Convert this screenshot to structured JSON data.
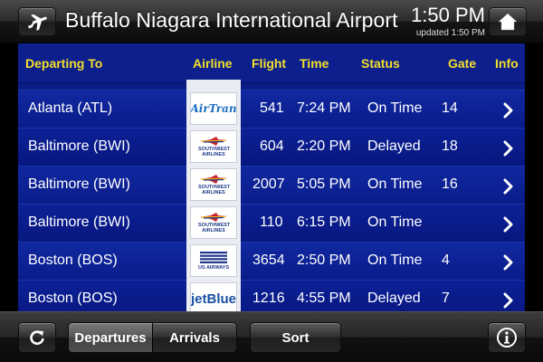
{
  "header": {
    "title": "Buffalo Niagara International Airport",
    "time": "1:50 PM",
    "updated": "updated 1:50 PM",
    "left_icon": "airplane-icon",
    "right_icon": "home-icon"
  },
  "columns": {
    "departing_to": "Departing To",
    "airline": "Airline",
    "flight": "Flight",
    "time": "Time",
    "status": "Status",
    "gate": "Gate",
    "info": "Info"
  },
  "flights": [
    {
      "destination": "Atlanta (ATL)",
      "airline_logo": "AirTran",
      "flight": "541",
      "time": "7:24 PM",
      "status": "On Time",
      "gate": "14"
    },
    {
      "destination": "Baltimore (BWI)",
      "airline_logo": "SOUTHWEST AIRLINES",
      "flight": "604",
      "time": "2:20 PM",
      "status": "Delayed",
      "gate": "18"
    },
    {
      "destination": "Baltimore (BWI)",
      "airline_logo": "SOUTHWEST AIRLINES",
      "flight": "2007",
      "time": "5:05 PM",
      "status": "On Time",
      "gate": "16"
    },
    {
      "destination": "Baltimore (BWI)",
      "airline_logo": "SOUTHWEST AIRLINES",
      "flight": "110",
      "time": "6:15 PM",
      "status": "On Time",
      "gate": ""
    },
    {
      "destination": "Boston (BOS)",
      "airline_logo": "US AIRWAYS",
      "flight": "3654",
      "time": "2:50 PM",
      "status": "On Time",
      "gate": "4"
    },
    {
      "destination": "Boston (BOS)",
      "airline_logo": "jetBlue",
      "flight": "1216",
      "time": "4:55 PM",
      "status": "Delayed",
      "gate": "7"
    }
  ],
  "toolbar": {
    "refresh_icon": "refresh-icon",
    "departures": "Departures",
    "arrivals": "Arrivals",
    "sort": "Sort",
    "info_icon": "info-icon",
    "active_tab": "Departures"
  },
  "colors": {
    "board_blue": "#0a1d86",
    "header_yellow": "#f6df2a",
    "text_white": "#ffffff"
  }
}
